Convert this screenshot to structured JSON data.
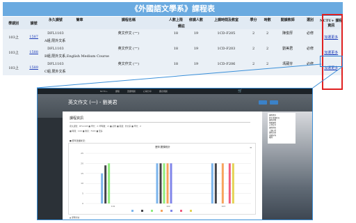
{
  "page": {
    "title": "《外國語文學系》課程表"
  },
  "table": {
    "headers": [
      "學期別",
      "課號",
      "永久課號",
      "簡章",
      "課程名稱",
      "人數上限",
      "修課人數",
      "上課時間及教室",
      "學分",
      "時數",
      "開課教師",
      "選別",
      "NCTU+ 課程資訊"
    ],
    "memo_header": "備註",
    "rows": [
      {
        "term": "103上",
        "course_no": "1587",
        "perm_no": "DFL1103",
        "name": "英文作文 (一)",
        "limit": "18",
        "enrolled": "19",
        "time_room": "1CD-F205",
        "credits": "2",
        "hours": "2",
        "teacher": "陳俊厚",
        "type": "必修",
        "info": "加選更多",
        "memo": "A組,限外文系"
      },
      {
        "term": "103上",
        "course_no": "1588",
        "perm_no": "DFL1103",
        "name": "英文作文 (一)",
        "limit": "18",
        "enrolled": "19",
        "time_room": "1CD-F203",
        "credits": "2",
        "hours": "2",
        "teacher": "劉美君",
        "type": "必修",
        "info": "加選更多",
        "memo": "B組,限外文系,English Medium Course"
      },
      {
        "term": "103上",
        "course_no": "1589",
        "perm_no": "DFL1103",
        "name": "英文作文 (一)",
        "limit": "18",
        "enrolled": "19",
        "time_room": "1CD-F206",
        "credits": "2",
        "hours": "2",
        "teacher": "馮葳芬",
        "type": "必修",
        "info": "加選更多",
        "memo": "C組,限外文系"
      }
    ]
  },
  "screenshot": {
    "nav_items": [
      "NCTU+",
      "課程",
      "選課規劃",
      "心得分享",
      "課表規劃"
    ],
    "cart_icon": "cart-icon",
    "course_title": "英文作文 (一) - 劉美君",
    "card_heading": "課程資訊",
    "meta_line1": "永久課號：DFL1103 ■ 學分：2 (學時數：2) ■ 必修 ■ 開課：外文系 ■ 學分：2",
    "meta_line2": "■ 時間：1CD ■ 教室：F203 ■ 更多",
    "section_label": "■ 歷年選課狀況：",
    "chart_title": "歷年選課統計",
    "foot_label": "▲ 課程討論",
    "sidebar_items": [
      "課程資訊",
      "歷年選課狀況",
      "課程評價",
      "相關課程",
      "心得分享",
      "課程問答",
      "上課心得",
      "課程討論",
      "成績分佈",
      "教師"
    ],
    "colors": {
      "title_bar": "#6aaae0",
      "header_bg": "#e1eaf3",
      "row_bg": "#eaf0f6",
      "link": "#1a39b8",
      "highlight_red": "#e02020",
      "callout_blue": "#3a8fd9"
    }
  },
  "chart_data": {
    "type": "bar",
    "title": "歷年選課統計",
    "xlabel": "",
    "ylabel": "",
    "ylim": [
      0,
      25
    ],
    "categories": [
      "101",
      "102",
      "103"
    ],
    "series": [
      {
        "values": [
          15,
          20,
          20
        ],
        "color": "#7cb5ec"
      },
      {
        "values": [
          19,
          20,
          20
        ],
        "color": "#434348"
      },
      {
        "values": [
          20,
          20,
          0
        ],
        "color": "#90ed7d"
      },
      {
        "values": [
          0,
          20,
          20
        ],
        "color": "#f7a35c"
      },
      {
        "values": [
          0,
          20,
          0
        ],
        "color": "#8085e9"
      },
      {
        "values": [
          0,
          0,
          20
        ],
        "color": "#f15c80"
      },
      {
        "values": [
          0,
          0,
          20
        ],
        "color": "#e4d354"
      }
    ]
  }
}
